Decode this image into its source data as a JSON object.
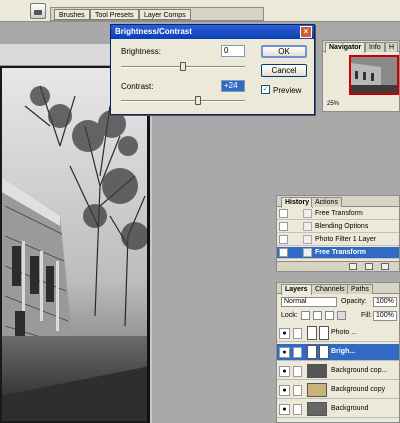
{
  "options_bar": {
    "tabs": [
      "Brushes",
      "Tool Presets",
      "Layer Comps"
    ]
  },
  "dialog": {
    "title": "Brightness/Contrast",
    "close_glyph": "×",
    "brightness_label": "Brightness:",
    "brightness_value": "0",
    "brightness_level": 0,
    "contrast_label": "Contrast:",
    "contrast_value": "+24",
    "contrast_level": 24,
    "ok_label": "OK",
    "cancel_label": "Cancel",
    "preview_label": "Preview",
    "preview_checked": true,
    "check_glyph": "✓"
  },
  "navigator": {
    "tabs": [
      "Navigator",
      "Info",
      "H"
    ],
    "zoom": "25%"
  },
  "history": {
    "tabs": [
      "History",
      "Actions"
    ],
    "items": [
      "Free Transform",
      "Blending Options",
      "Photo Filter 1 Layer",
      "Free Transform"
    ],
    "active_index": 3
  },
  "layers": {
    "tabs": [
      "Layers",
      "Channels",
      "Paths"
    ],
    "blend_mode": "Normal",
    "opacity_label": "Opacity:",
    "opacity_value": "100%",
    "lock_label": "Lock:",
    "fill_label": "Fill:",
    "fill_value": "100%",
    "eye_glyph": "●",
    "rows": [
      {
        "name": "Photo ...",
        "active": false
      },
      {
        "name": "Brigh...",
        "active": true
      },
      {
        "name": "Background cop...",
        "active": false
      },
      {
        "name": "Background copy",
        "active": false
      },
      {
        "name": "Background",
        "active": false
      }
    ]
  },
  "colors": {
    "selection": "#316ac5",
    "titlebar": "#0a3fb4",
    "panel_bg": "#ece9d8",
    "workspace": "#a9a9a9"
  }
}
